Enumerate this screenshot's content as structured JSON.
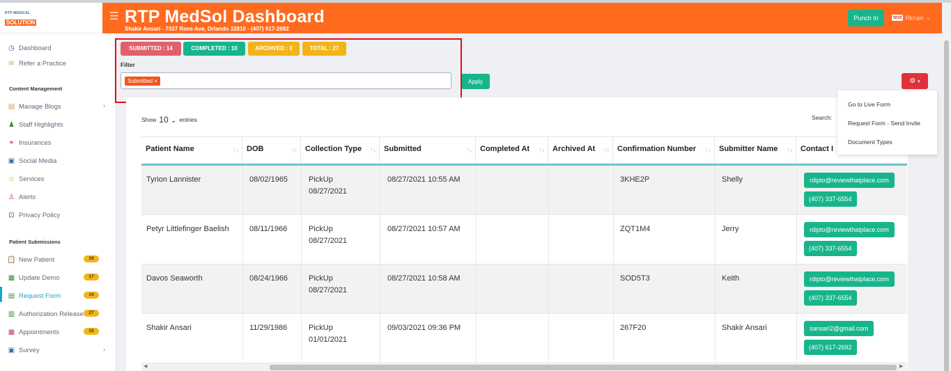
{
  "logo": {
    "line1": "RTP MEDICAL",
    "line2": "SOLUTION"
  },
  "header": {
    "title": "RTP MedSol Dashboard",
    "subtitle": "Shakir Ansari - 7037 Rose Ave, Orlando 32810 - (407) 617-2692",
    "punch_in": "Punch In",
    "user_badge": "test",
    "user_name": "Rkhan"
  },
  "sidebar": {
    "top_items": [
      {
        "label": "Dashboard"
      },
      {
        "label": "Refer a Practice"
      }
    ],
    "content_section": "Content Management",
    "content_items": [
      {
        "label": "Manage Blogs"
      },
      {
        "label": "Staff Highlights"
      },
      {
        "label": "Insurances"
      },
      {
        "label": "Social Media"
      },
      {
        "label": "Services"
      },
      {
        "label": "Alerts"
      },
      {
        "label": "Privacy Policy"
      }
    ],
    "patient_section": "Patient Submissions",
    "patient_items": [
      {
        "label": "New Patient",
        "count": "19"
      },
      {
        "label": "Update Demo",
        "count": "17"
      },
      {
        "label": "Request Form",
        "count": "14"
      },
      {
        "label": "Authorization Release",
        "count": "27"
      },
      {
        "label": "Appointments",
        "count": "19"
      },
      {
        "label": "Survey",
        "count": ""
      }
    ]
  },
  "status": {
    "submitted": "SUBMITTED : 14",
    "completed": "COMPLETED : 10",
    "archived": "ARCHIVED : 3",
    "total": "TOTAL : 27"
  },
  "filter": {
    "label": "Filter",
    "tag": "Submitted ×",
    "apply": "Apply"
  },
  "dropdown": {
    "items": [
      "Go to Live Form",
      "Request Form - Send Invite",
      "Document Types"
    ]
  },
  "table_controls": {
    "show": "Show",
    "entries_value": "10",
    "entries": "entries",
    "search": "Search:"
  },
  "table": {
    "headers": [
      "Patient Name",
      "DOB",
      "Collection Type",
      "Submitted",
      "Completed At",
      "Archived At",
      "Confirmation Number",
      "Submitter Name",
      "Contact I"
    ],
    "rows": [
      {
        "name": "Tyrion Lannister",
        "dob": "08/02/1965",
        "type": "PickUp",
        "type_date": "08/27/2021",
        "submitted": "08/27/2021 10:55 AM",
        "completed": "",
        "archived": "",
        "confirmation": "3KHE2P",
        "submitter": "Shelly",
        "email": "rdipto@reviewthatplace.com",
        "phone": "(407) 337-6554"
      },
      {
        "name": "Petyr Littlefinger Baelish",
        "dob": "08/11/1966",
        "type": "PickUp",
        "type_date": "08/27/2021",
        "submitted": "08/27/2021 10:57 AM",
        "completed": "",
        "archived": "",
        "confirmation": "ZQT1M4",
        "submitter": "Jerry",
        "email": "rdipto@reviewthatplace.com",
        "phone": "(407) 337-6554"
      },
      {
        "name": "Davos Seaworth",
        "dob": "08/24/1966",
        "type": "PickUp",
        "type_date": "08/27/2021",
        "submitted": "08/27/2021 10:58 AM",
        "completed": "",
        "archived": "",
        "confirmation": "SOD5T3",
        "submitter": "Keith",
        "email": "rdipto@reviewthatplace.com",
        "phone": "(407) 337-6554"
      },
      {
        "name": "Shakir Ansari",
        "dob": "11/29/1986",
        "type": "PickUp",
        "type_date": "01/01/2021",
        "submitted": "09/03/2021 09:36 PM",
        "completed": "",
        "archived": "",
        "confirmation": "267F20",
        "submitter": "Shakir Ansari",
        "email": "sansari2@gmail.com",
        "phone": "(407) 617-2692"
      }
    ]
  },
  "colors": {
    "accent": "#ff6a1f",
    "success": "#18b58c",
    "danger": "#e0606b",
    "warning": "#f3b41a",
    "highlight": "#e30c13"
  }
}
